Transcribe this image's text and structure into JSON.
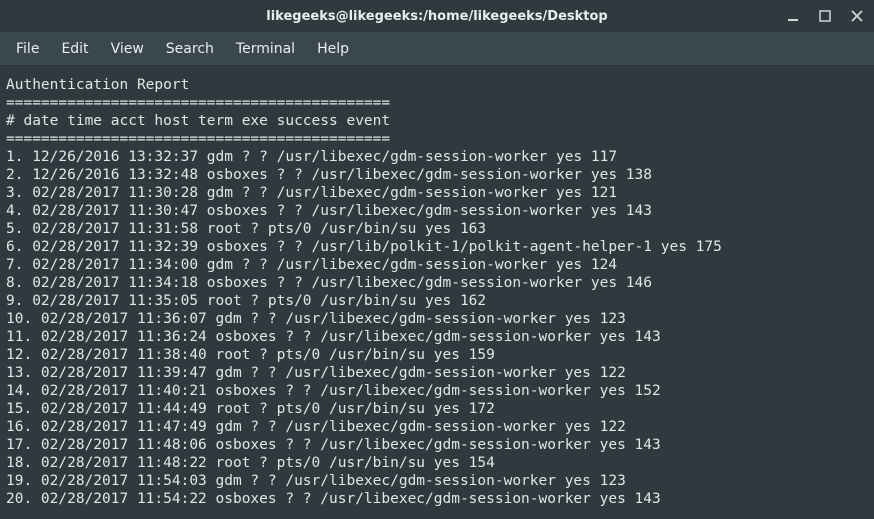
{
  "window": {
    "title": "likegeeks@likegeeks:/home/likegeeks/Desktop"
  },
  "menu": {
    "file": "File",
    "edit": "Edit",
    "view": "View",
    "search": "Search",
    "terminal": "Terminal",
    "help": "Help"
  },
  "report": {
    "title": "Authentication Report",
    "separator": "============================================",
    "header": "# date time acct host term exe success event",
    "rows": [
      {
        "n": "1",
        "date": "12/26/2016",
        "time": "13:32:37",
        "acct": "gdm",
        "host": "?",
        "term": "?",
        "exe": "/usr/libexec/gdm-session-worker",
        "success": "yes",
        "event": "117"
      },
      {
        "n": "2",
        "date": "12/26/2016",
        "time": "13:32:48",
        "acct": "osboxes",
        "host": "?",
        "term": "?",
        "exe": "/usr/libexec/gdm-session-worker",
        "success": "yes",
        "event": "138"
      },
      {
        "n": "3",
        "date": "02/28/2017",
        "time": "11:30:28",
        "acct": "gdm",
        "host": "?",
        "term": "?",
        "exe": "/usr/libexec/gdm-session-worker",
        "success": "yes",
        "event": "121"
      },
      {
        "n": "4",
        "date": "02/28/2017",
        "time": "11:30:47",
        "acct": "osboxes",
        "host": "?",
        "term": "?",
        "exe": "/usr/libexec/gdm-session-worker",
        "success": "yes",
        "event": "143"
      },
      {
        "n": "5",
        "date": "02/28/2017",
        "time": "11:31:58",
        "acct": "root",
        "host": "?",
        "term": "pts/0",
        "exe": "/usr/bin/su",
        "success": "yes",
        "event": "163"
      },
      {
        "n": "6",
        "date": "02/28/2017",
        "time": "11:32:39",
        "acct": "osboxes",
        "host": "?",
        "term": "?",
        "exe": "/usr/lib/polkit-1/polkit-agent-helper-1",
        "success": "yes",
        "event": "175"
      },
      {
        "n": "7",
        "date": "02/28/2017",
        "time": "11:34:00",
        "acct": "gdm",
        "host": "?",
        "term": "?",
        "exe": "/usr/libexec/gdm-session-worker",
        "success": "yes",
        "event": "124"
      },
      {
        "n": "8",
        "date": "02/28/2017",
        "time": "11:34:18",
        "acct": "osboxes",
        "host": "?",
        "term": "?",
        "exe": "/usr/libexec/gdm-session-worker",
        "success": "yes",
        "event": "146"
      },
      {
        "n": "9",
        "date": "02/28/2017",
        "time": "11:35:05",
        "acct": "root",
        "host": "?",
        "term": "pts/0",
        "exe": "/usr/bin/su",
        "success": "yes",
        "event": "162"
      },
      {
        "n": "10",
        "date": "02/28/2017",
        "time": "11:36:07",
        "acct": "gdm",
        "host": "?",
        "term": "?",
        "exe": "/usr/libexec/gdm-session-worker",
        "success": "yes",
        "event": "123"
      },
      {
        "n": "11",
        "date": "02/28/2017",
        "time": "11:36:24",
        "acct": "osboxes",
        "host": "?",
        "term": "?",
        "exe": "/usr/libexec/gdm-session-worker",
        "success": "yes",
        "event": "143"
      },
      {
        "n": "12",
        "date": "02/28/2017",
        "time": "11:38:40",
        "acct": "root",
        "host": "?",
        "term": "pts/0",
        "exe": "/usr/bin/su",
        "success": "yes",
        "event": "159"
      },
      {
        "n": "13",
        "date": "02/28/2017",
        "time": "11:39:47",
        "acct": "gdm",
        "host": "?",
        "term": "?",
        "exe": "/usr/libexec/gdm-session-worker",
        "success": "yes",
        "event": "122"
      },
      {
        "n": "14",
        "date": "02/28/2017",
        "time": "11:40:21",
        "acct": "osboxes",
        "host": "?",
        "term": "?",
        "exe": "/usr/libexec/gdm-session-worker",
        "success": "yes",
        "event": "152"
      },
      {
        "n": "15",
        "date": "02/28/2017",
        "time": "11:44:49",
        "acct": "root",
        "host": "?",
        "term": "pts/0",
        "exe": "/usr/bin/su",
        "success": "yes",
        "event": "172"
      },
      {
        "n": "16",
        "date": "02/28/2017",
        "time": "11:47:49",
        "acct": "gdm",
        "host": "?",
        "term": "?",
        "exe": "/usr/libexec/gdm-session-worker",
        "success": "yes",
        "event": "122"
      },
      {
        "n": "17",
        "date": "02/28/2017",
        "time": "11:48:06",
        "acct": "osboxes",
        "host": "?",
        "term": "?",
        "exe": "/usr/libexec/gdm-session-worker",
        "success": "yes",
        "event": "143"
      },
      {
        "n": "18",
        "date": "02/28/2017",
        "time": "11:48:22",
        "acct": "root",
        "host": "?",
        "term": "pts/0",
        "exe": "/usr/bin/su",
        "success": "yes",
        "event": "154"
      },
      {
        "n": "19",
        "date": "02/28/2017",
        "time": "11:54:03",
        "acct": "gdm",
        "host": "?",
        "term": "?",
        "exe": "/usr/libexec/gdm-session-worker",
        "success": "yes",
        "event": "123"
      },
      {
        "n": "20",
        "date": "02/28/2017",
        "time": "11:54:22",
        "acct": "osboxes",
        "host": "?",
        "term": "?",
        "exe": "/usr/libexec/gdm-session-worker",
        "success": "yes",
        "event": "143"
      }
    ]
  }
}
